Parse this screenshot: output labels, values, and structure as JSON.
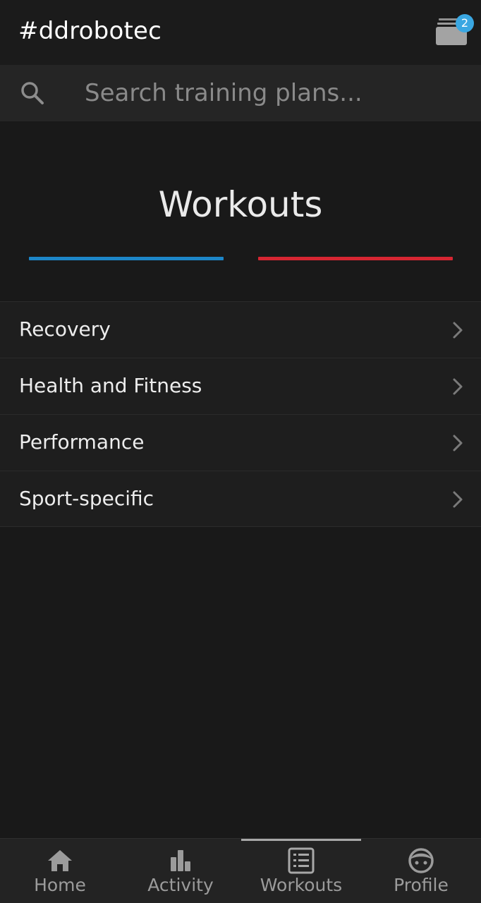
{
  "header": {
    "title": "#ddrobotec",
    "inbox_badge": "2"
  },
  "search": {
    "placeholder": "Search training plans..."
  },
  "section": {
    "title": "Workouts"
  },
  "categories": [
    {
      "label": "Recovery"
    },
    {
      "label": "Health and Fitness"
    },
    {
      "label": "Performance"
    },
    {
      "label": "Sport-specific"
    }
  ],
  "bottom_nav": {
    "items": [
      {
        "label": "Home",
        "icon": "home-icon"
      },
      {
        "label": "Activity",
        "icon": "bar-chart-icon"
      },
      {
        "label": "Workouts",
        "icon": "list-icon",
        "active": true
      },
      {
        "label": "Profile",
        "icon": "face-icon"
      }
    ]
  },
  "colors": {
    "accent_blue": "#1d86c8",
    "accent_red": "#d62632",
    "badge": "#3aa7e2",
    "background": "#191919"
  }
}
